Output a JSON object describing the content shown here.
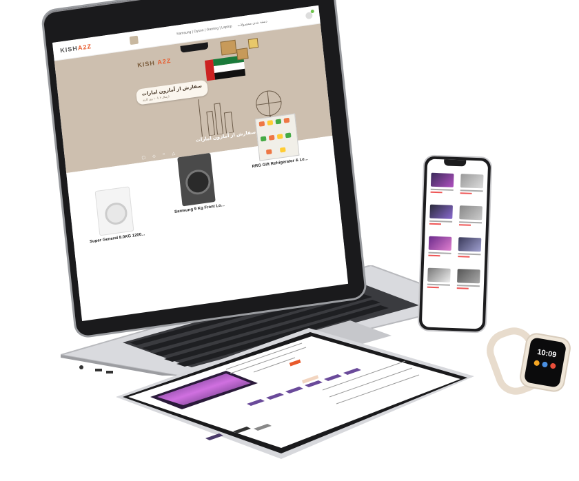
{
  "laptop": {
    "topbar": {
      "logo_main": "KISH",
      "logo_accent": "A2Z",
      "links": [
        "Samsung | Dyson | Gaming | Laptop",
        "دسته بندی محصولات"
      ]
    },
    "hero": {
      "brand_main": "KISH",
      "brand_accent": "A2Z",
      "promo_title": "سفارش از آمازون امارات",
      "promo_sub": "ارسال ۷ تا ۱۰ روز کاری",
      "tagline": "سفارش از آمازون امارات"
    },
    "products": [
      {
        "name": "Super General 8.0KG 1200..."
      },
      {
        "name": "Samsung 9 Kg Front Lo..."
      },
      {
        "name": "RRG Gift Refrigerator & Le..."
      }
    ]
  },
  "watch": {
    "time": "10:09"
  },
  "colors": {
    "hero_bg": "#cdbfaf",
    "accent": "#e85a2c",
    "device_frame": "#1a1a1c"
  }
}
